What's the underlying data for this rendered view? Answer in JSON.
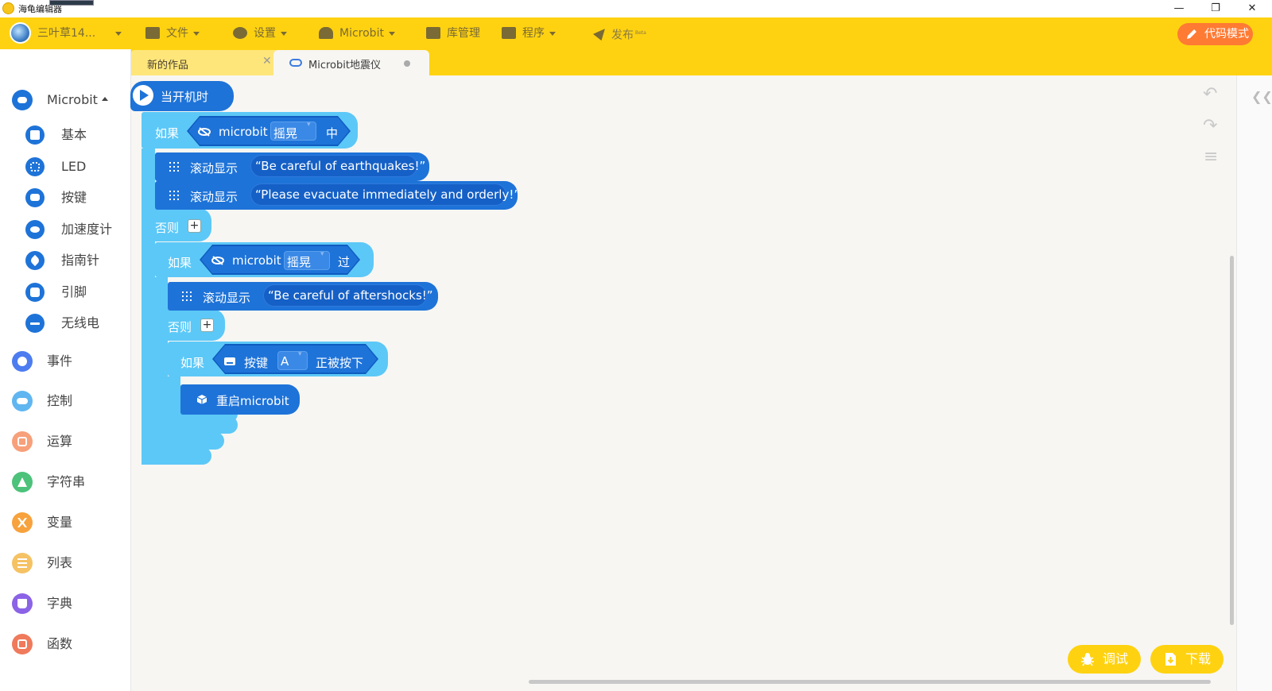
{
  "window": {
    "title": "海龟编辑器",
    "minimize": "—",
    "restore": "❐",
    "close": "✕"
  },
  "toolbar": {
    "user_name": "三叶草14...",
    "file": "文件",
    "settings": "设置",
    "microbit": "Microbit",
    "library": "库管理",
    "program": "程序",
    "publish": "发布",
    "publish_badge": "Beta",
    "code_mode": "代码模式"
  },
  "tabs": [
    {
      "label": "新的作品",
      "close": "✕"
    },
    {
      "label": "Microbit地震仪"
    }
  ],
  "sidebar": {
    "microbit": "Microbit",
    "subcategories": [
      "基本",
      "LED",
      "按键",
      "加速度计",
      "指南针",
      "引脚",
      "无线电"
    ],
    "categories": [
      "事件",
      "控制",
      "运算",
      "字符串",
      "变量",
      "列表",
      "字典",
      "函数"
    ],
    "colors": {
      "microbit": "#1e73d8",
      "events": "#4c7cf0",
      "control": "#60b6f0",
      "operators": "#f7a07a",
      "strings": "#4cc27a",
      "variables": "#f7a23d",
      "lists": "#f5c264",
      "dictionaries": "#8b63e6",
      "functions": "#f07a5c"
    }
  },
  "blocks": {
    "hat": "当开机时",
    "if1": "如果",
    "microbit1": "microbit",
    "gesture1": "摇晃",
    "state1": "中",
    "scroll": "滚动显示",
    "msg1": "“Be careful of earthquakes!”",
    "msg2": "“Please evacuate immediately and orderly!”",
    "else1": "否则",
    "if2": "如果",
    "microbit2": "microbit",
    "gesture2": "摇晃",
    "state2": "过",
    "msg3": "“Be careful of aftershocks!”",
    "else2": "否则",
    "if3": "如果",
    "button_lbl": "按键",
    "button_val": "A",
    "pressed": "正被按下",
    "reset": "重启microbit",
    "plus": "+"
  },
  "buttons": {
    "debug": "调试",
    "download": "下载"
  },
  "icons": {
    "undo": "↶",
    "redo": "↷",
    "align": "≡",
    "collapse": "❮❮"
  }
}
